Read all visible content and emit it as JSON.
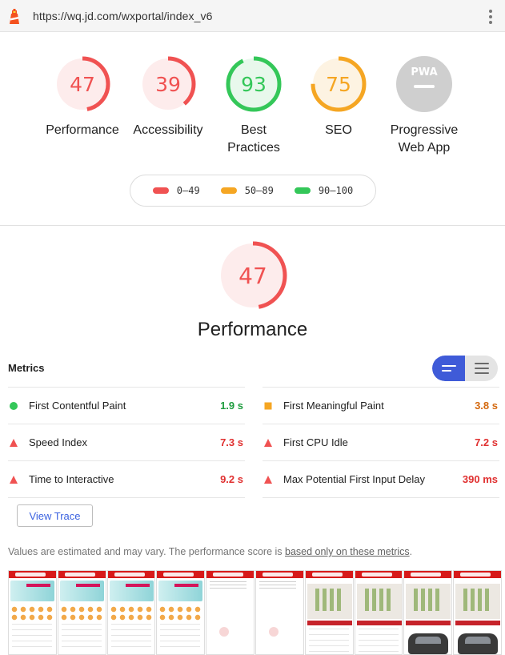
{
  "browser": {
    "url": "https://wq.jd.com/wxportal/index_v6",
    "logo_icon": "lighthouse-icon",
    "menu_icon": "kebab-menu-icon"
  },
  "gauges": [
    {
      "label": "Performance",
      "score": "47",
      "fraction": 0.47,
      "color": "#f05252",
      "bg": "#fdecec"
    },
    {
      "label": "Accessibility",
      "score": "39",
      "fraction": 0.39,
      "color": "#f05252",
      "bg": "#fdecec"
    },
    {
      "label": "Best Practices",
      "label_line1": "Best",
      "label_line2": "Practices",
      "score": "93",
      "fraction": 0.93,
      "color": "#34c759",
      "bg": "#e8f8ec"
    },
    {
      "label": "SEO",
      "score": "75",
      "fraction": 0.75,
      "color": "#f5a623",
      "bg": "#fdf3e2"
    },
    {
      "label": "Progressive Web App",
      "label_line1": "Progressive",
      "label_line2": "Web App",
      "badge": "PWA",
      "color": "#cfcfcf"
    }
  ],
  "legend": [
    {
      "range": "0–49",
      "color": "#f05252"
    },
    {
      "range": "50–89",
      "color": "#f5a623"
    },
    {
      "range": "90–100",
      "color": "#34c759"
    }
  ],
  "performance": {
    "score": "47",
    "fraction": 0.47,
    "title": "Performance"
  },
  "metrics": {
    "title": "Metrics",
    "left": [
      {
        "name": "First Contentful Paint",
        "value": "1.9 s",
        "status": "pass",
        "color": "#1e9c3e"
      },
      {
        "name": "Speed Index",
        "value": "7.3 s",
        "status": "fail",
        "color": "#e03030"
      },
      {
        "name": "Time to Interactive",
        "value": "9.2 s",
        "status": "fail",
        "color": "#e03030"
      }
    ],
    "right": [
      {
        "name": "First Meaningful Paint",
        "value": "3.8 s",
        "status": "average",
        "color": "#d4690f"
      },
      {
        "name": "First CPU Idle",
        "value": "7.2 s",
        "status": "fail",
        "color": "#e03030"
      },
      {
        "name": "Max Potential First Input Delay",
        "value": "390 ms",
        "status": "fail",
        "color": "#e03030"
      }
    ]
  },
  "view_trace_label": "View Trace",
  "note": {
    "prefix": "Values are estimated and may vary. The performance score is ",
    "link": "based only on these metrics",
    "suffix": "."
  },
  "filmstrip_frames": 10
}
